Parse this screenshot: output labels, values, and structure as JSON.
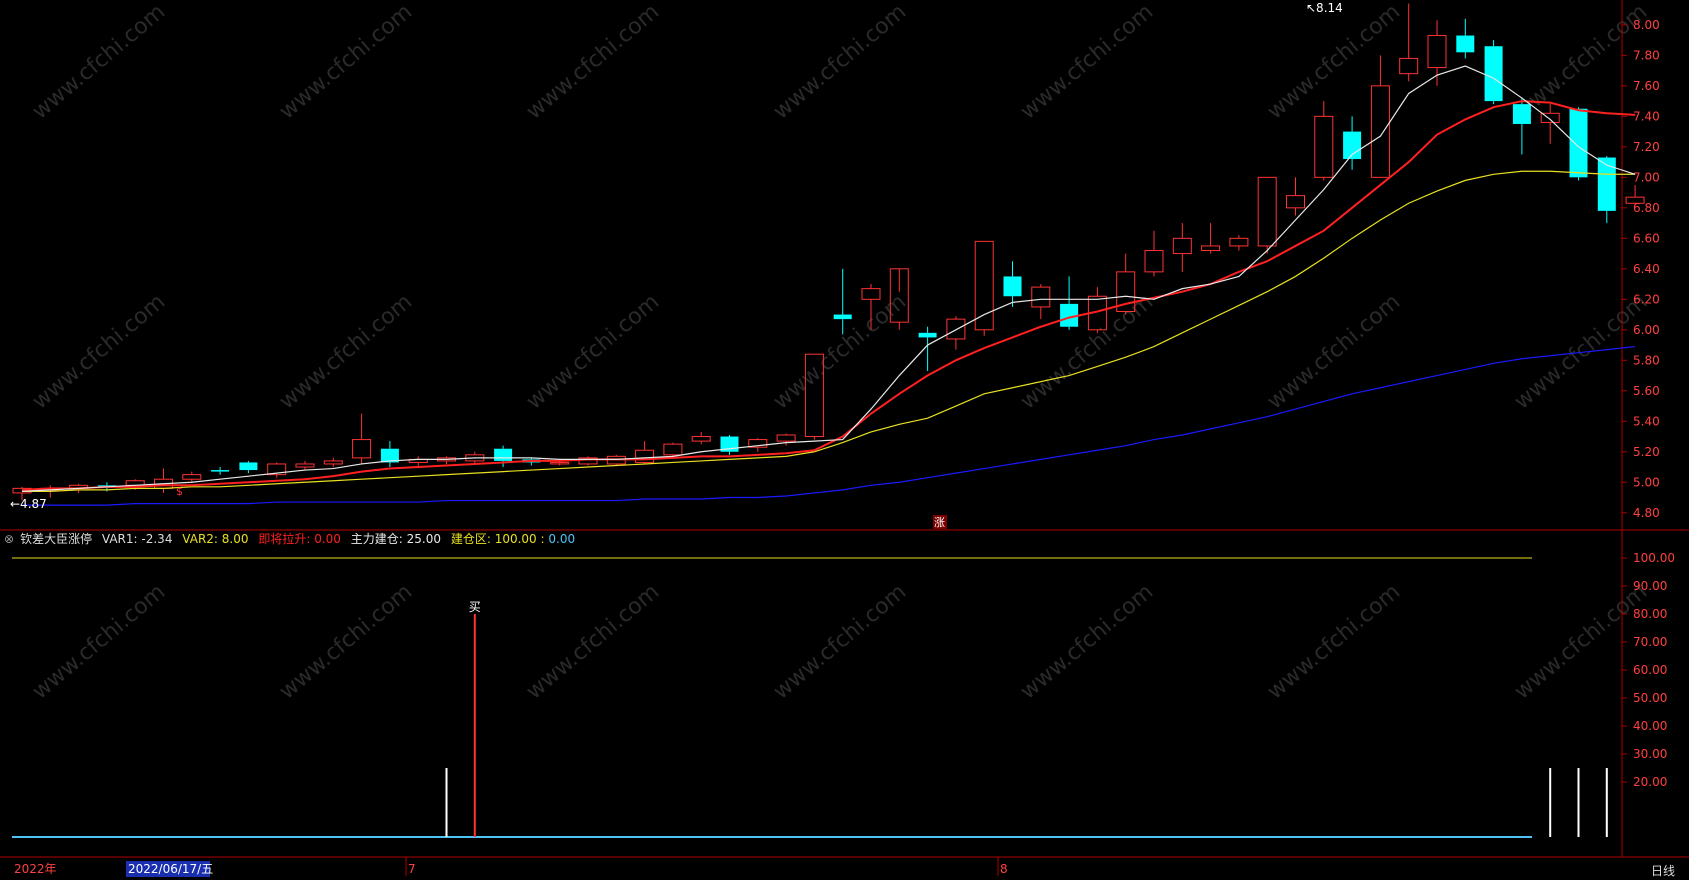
{
  "indicator": {
    "name": "钦差大臣涨停",
    "var1_label": "VAR1:",
    "var1_value": "-2.34",
    "var2_label": "VAR2:",
    "var2_value": "8.00",
    "pull_label": "即将拉升:",
    "pull_value": "0.00",
    "main_label": "主力建仓:",
    "main_value": "25.00",
    "zone_label": "建仓区:",
    "zone_value1": "100.00",
    "zone_value2": "0.00"
  },
  "timeframe": "日线",
  "x_axis": {
    "year": "2022年",
    "cursor_date": "2022/06/17/五",
    "month7": "7",
    "month8": "8"
  },
  "markers": {
    "low": "4.87",
    "high": "8.14",
    "buy": "买",
    "rise": "涨",
    "sell": "$"
  },
  "watermark": "www.cfchi.com",
  "colors": {
    "bg": "#000000",
    "up": "#ff3333",
    "down": "#00ffff",
    "ma5": "#e8e8e8",
    "ma10": "#ff2020",
    "ma20": "#e8e020",
    "ma60": "#1a1aff",
    "axis": "#b00000",
    "tick": "#ff4040",
    "vol_line": "#4fc3f7"
  },
  "chart_data": [
    {
      "type": "candlestick",
      "ylim": [
        4.7,
        8.15
      ],
      "y_ticks": [
        "4.80",
        "5.00",
        "5.20",
        "5.40",
        "5.60",
        "5.80",
        "6.00",
        "6.20",
        "6.40",
        "6.60",
        "6.80",
        "7.00",
        "7.20",
        "7.40",
        "7.60",
        "7.80",
        "8.00"
      ],
      "candles": [
        [
          4.93,
          4.96,
          4.88,
          4.97
        ],
        [
          4.95,
          4.96,
          4.9,
          4.98
        ],
        [
          4.96,
          4.98,
          4.93,
          4.99
        ],
        [
          4.98,
          4.97,
          4.94,
          5.0
        ],
        [
          4.98,
          5.01,
          4.95,
          5.02
        ],
        [
          4.96,
          5.02,
          4.93,
          5.09
        ],
        [
          5.02,
          5.05,
          5.0,
          5.07
        ],
        [
          5.08,
          5.07,
          5.05,
          5.1
        ],
        [
          5.13,
          5.08,
          5.06,
          5.14
        ],
        [
          5.05,
          5.12,
          5.03,
          5.13
        ],
        [
          5.1,
          5.12,
          5.08,
          5.14
        ],
        [
          5.12,
          5.14,
          5.1,
          5.16
        ],
        [
          5.16,
          5.28,
          5.12,
          5.45
        ],
        [
          5.22,
          5.13,
          5.1,
          5.27
        ],
        [
          5.13,
          5.15,
          5.1,
          5.17
        ],
        [
          5.14,
          5.16,
          5.12,
          5.17
        ],
        [
          5.14,
          5.18,
          5.12,
          5.2
        ],
        [
          5.22,
          5.14,
          5.1,
          5.24
        ],
        [
          5.15,
          5.13,
          5.11,
          5.16
        ],
        [
          5.13,
          5.13,
          5.11,
          5.15
        ],
        [
          5.12,
          5.16,
          5.11,
          5.17
        ],
        [
          5.12,
          5.17,
          5.11,
          5.18
        ],
        [
          5.13,
          5.21,
          5.12,
          5.27
        ],
        [
          5.18,
          5.25,
          5.16,
          5.26
        ],
        [
          5.27,
          5.3,
          5.25,
          5.33
        ],
        [
          5.3,
          5.2,
          5.18,
          5.31
        ],
        [
          5.23,
          5.28,
          5.2,
          5.29
        ],
        [
          5.27,
          5.31,
          5.24,
          5.32
        ],
        [
          5.3,
          5.84,
          5.28,
          5.84
        ],
        [
          6.1,
          6.07,
          5.97,
          6.4
        ],
        [
          6.2,
          6.27,
          6.0,
          6.3
        ],
        [
          6.05,
          6.4,
          6.0,
          6.25
        ],
        [
          5.98,
          5.95,
          5.73,
          6.02
        ],
        [
          5.94,
          6.07,
          5.87,
          6.09
        ],
        [
          6.0,
          6.58,
          5.96,
          6.58
        ],
        [
          6.35,
          6.22,
          6.15,
          6.45
        ],
        [
          6.15,
          6.28,
          6.07,
          6.3
        ],
        [
          6.17,
          6.02,
          6.0,
          6.35
        ],
        [
          6.0,
          6.22,
          5.98,
          6.28
        ],
        [
          6.12,
          6.38,
          6.1,
          6.5
        ],
        [
          6.38,
          6.52,
          6.35,
          6.65
        ],
        [
          6.5,
          6.6,
          6.38,
          6.7
        ],
        [
          6.52,
          6.55,
          6.5,
          6.7
        ],
        [
          6.55,
          6.6,
          6.52,
          6.62
        ],
        [
          6.55,
          7.0,
          6.5,
          7.0
        ],
        [
          6.8,
          6.88,
          6.75,
          7.0
        ],
        [
          7.0,
          7.4,
          6.98,
          7.5
        ],
        [
          7.3,
          7.12,
          7.05,
          7.4
        ],
        [
          7.0,
          7.6,
          7.0,
          7.8
        ],
        [
          7.68,
          7.78,
          7.63,
          8.14
        ],
        [
          7.72,
          7.93,
          7.6,
          8.03
        ],
        [
          7.93,
          7.82,
          7.78,
          8.04
        ],
        [
          7.86,
          7.5,
          7.48,
          7.9
        ],
        [
          7.48,
          7.35,
          7.15,
          7.52
        ],
        [
          7.36,
          7.42,
          7.22,
          7.48
        ],
        [
          7.45,
          7.0,
          6.98,
          7.46
        ],
        [
          7.13,
          6.78,
          6.7,
          7.14
        ],
        [
          6.83,
          6.87,
          6.82,
          6.95
        ]
      ],
      "ma5": [
        4.94,
        4.95,
        4.96,
        4.97,
        4.98,
        4.99,
        5.0,
        5.02,
        5.04,
        5.06,
        5.08,
        5.09,
        5.12,
        5.14,
        5.15,
        5.15,
        5.16,
        5.16,
        5.16,
        5.15,
        5.15,
        5.15,
        5.16,
        5.17,
        5.2,
        5.22,
        5.24,
        5.26,
        5.27,
        5.28,
        5.48,
        5.7,
        5.9,
        6.0,
        6.1,
        6.18,
        6.2,
        6.2,
        6.2,
        6.22,
        6.2,
        6.27,
        6.3,
        6.35,
        6.52,
        6.72,
        6.92,
        7.15,
        7.27,
        7.55,
        7.67,
        7.73,
        7.65,
        7.52,
        7.38,
        7.2,
        7.08,
        7.02
      ],
      "ma10": [
        4.95,
        4.96,
        4.96,
        4.97,
        4.97,
        4.98,
        4.98,
        4.99,
        5.0,
        5.01,
        5.02,
        5.04,
        5.07,
        5.09,
        5.1,
        5.11,
        5.12,
        5.13,
        5.14,
        5.14,
        5.15,
        5.15,
        5.15,
        5.16,
        5.17,
        5.17,
        5.18,
        5.19,
        5.21,
        5.3,
        5.45,
        5.58,
        5.7,
        5.8,
        5.88,
        5.95,
        6.02,
        6.08,
        6.12,
        6.17,
        6.21,
        6.25,
        6.3,
        6.38,
        6.45,
        6.55,
        6.65,
        6.8,
        6.95,
        7.1,
        7.28,
        7.38,
        7.46,
        7.5,
        7.49,
        7.44,
        7.42,
        7.41
      ],
      "ma20": [
        4.94,
        4.94,
        4.95,
        4.95,
        4.96,
        4.96,
        4.97,
        4.97,
        4.98,
        4.99,
        5.0,
        5.01,
        5.02,
        5.03,
        5.04,
        5.05,
        5.06,
        5.07,
        5.08,
        5.09,
        5.1,
        5.11,
        5.12,
        5.13,
        5.14,
        5.15,
        5.16,
        5.17,
        5.2,
        5.26,
        5.33,
        5.38,
        5.42,
        5.5,
        5.58,
        5.62,
        5.66,
        5.7,
        5.76,
        5.82,
        5.89,
        5.98,
        6.07,
        6.16,
        6.25,
        6.35,
        6.47,
        6.6,
        6.72,
        6.83,
        6.91,
        6.98,
        7.02,
        7.04,
        7.04,
        7.03,
        7.02,
        7.02
      ],
      "ma60": [
        4.85,
        4.85,
        4.85,
        4.85,
        4.86,
        4.86,
        4.86,
        4.86,
        4.86,
        4.87,
        4.87,
        4.87,
        4.87,
        4.87,
        4.87,
        4.88,
        4.88,
        4.88,
        4.88,
        4.88,
        4.88,
        4.88,
        4.89,
        4.89,
        4.89,
        4.9,
        4.9,
        4.91,
        4.93,
        4.95,
        4.98,
        5.0,
        5.03,
        5.06,
        5.09,
        5.12,
        5.15,
        5.18,
        5.21,
        5.24,
        5.28,
        5.31,
        5.35,
        5.39,
        5.43,
        5.48,
        5.53,
        5.58,
        5.62,
        5.66,
        5.7,
        5.74,
        5.78,
        5.81,
        5.83,
        5.85,
        5.87,
        5.89
      ]
    },
    {
      "type": "bar",
      "ylim": [
        0,
        100
      ],
      "y_ticks": [
        "20.00",
        "30.00",
        "40.00",
        "50.00",
        "60.00",
        "70.00",
        "80.00",
        "90.00",
        "100.00"
      ],
      "series": [
        {
          "name": "建仓区",
          "values": [
            100
          ]
        },
        {
          "name": "主力建仓",
          "bars": [
            {
              "index": 15,
              "value": 25
            },
            {
              "index": 54,
              "value": 25
            },
            {
              "index": 55,
              "value": 25
            },
            {
              "index": 56,
              "value": 25
            }
          ]
        },
        {
          "name": "即将拉升",
          "bars": [
            {
              "index": 16,
              "value": 80
            }
          ]
        }
      ]
    }
  ]
}
